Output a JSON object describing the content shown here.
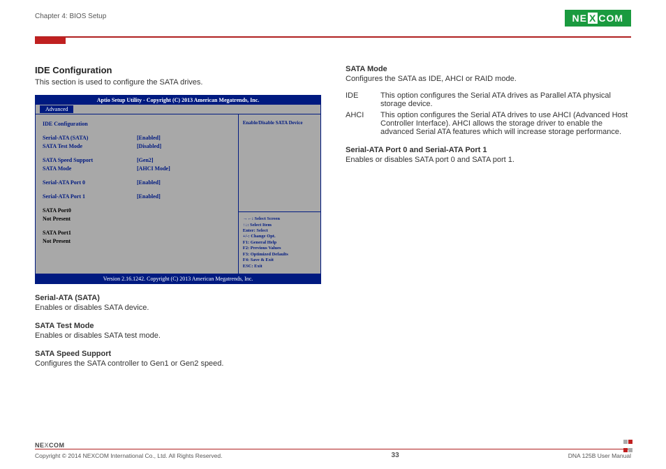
{
  "header": {
    "chapter": "Chapter 4: BIOS Setup",
    "brand": "NEXCOM"
  },
  "left": {
    "title": "IDE Configuration",
    "intro": "This section is used to configure the SATA drives."
  },
  "bios": {
    "top": "Aptio Setup Utility - Copyright (C) 2013 American Megatrends, Inc.",
    "tab": "Advanced",
    "heading": "IDE Configuration",
    "rows": [
      {
        "lbl": "Serial-ATA (SATA)",
        "val": "[Enabled]"
      },
      {
        "lbl": "SATA Test Mode",
        "val": "[Disabled]"
      }
    ],
    "rows2": [
      {
        "lbl": "SATA Speed Support",
        "val": "[Gen2]"
      },
      {
        "lbl": "SATA Mode",
        "val": "[AHCI Mode]"
      }
    ],
    "rows3": [
      {
        "lbl": "Serial-ATA Port 0",
        "val": "[Enabled]"
      }
    ],
    "rows4": [
      {
        "lbl": "Serial-ATA Port 1",
        "val": "[Enabled]"
      }
    ],
    "ports": [
      "SATA Port0",
      "Not Present",
      "",
      "SATA Port1",
      "Not Present"
    ],
    "help_top": "Enable/Disable SATA Device",
    "help_keys": [
      "→←: Select Screen",
      "↑↓: Select Item",
      "Enter: Select",
      "+/-: Change Opt.",
      "F1: General Help",
      "F2: Previous Values",
      "F3: Optimized Defaults",
      "F4: Save & Exit",
      "ESC: Exit"
    ],
    "bottom": "Version 2.16.1242. Copyright (C) 2013 American Megatrends, Inc."
  },
  "descs_left": [
    {
      "h": "Serial-ATA (SATA)",
      "p": "Enables or disables SATA device."
    },
    {
      "h": "SATA Test Mode",
      "p": "Enables or disables SATA test mode."
    },
    {
      "h": "SATA Speed Support",
      "p": "Configures the SATA controller to Gen1 or Gen2 speed."
    }
  ],
  "right": {
    "sata_mode_h": "SATA Mode",
    "sata_mode_p": "Configures the SATA as IDE, AHCI or RAID mode.",
    "opts": [
      {
        "k": "IDE",
        "v": "This option configures the Serial ATA drives as Parallel ATA physical  storage device."
      },
      {
        "k": "AHCI",
        "v": "This option configures the Serial ATA drives to use AHCI (Advanced Host Controller Interface). AHCI allows the storage driver to enable the advanced Serial ATA features which will increase storage performance."
      }
    ],
    "ports_h": "Serial-ATA Port 0 and Serial-ATA Port 1",
    "ports_p": "Enables or disables SATA port 0 and SATA port 1."
  },
  "footer": {
    "brand": "NEXCOM",
    "copyright": "Copyright © 2014 NEXCOM International Co., Ltd. All Rights Reserved.",
    "page": "33",
    "doc": "DNA 125B User Manual"
  }
}
